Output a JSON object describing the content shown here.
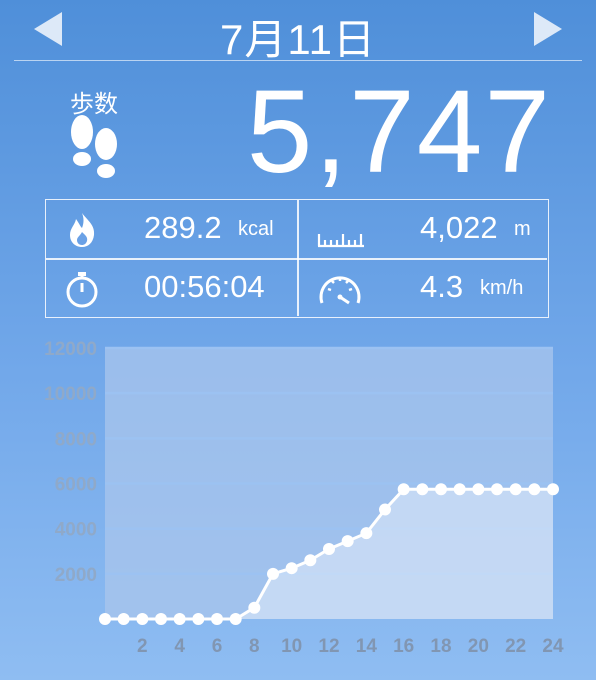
{
  "header": {
    "date": "7月11日",
    "prev_icon": "chevron-left-icon",
    "next_icon": "chevron-right-icon"
  },
  "steps": {
    "label": "歩数",
    "value": "5,747",
    "icon": "footprints-icon"
  },
  "stats": {
    "calories": {
      "value": "289.2",
      "unit": "kcal",
      "icon": "flame-icon"
    },
    "distance": {
      "value": "4,022",
      "unit": "m",
      "icon": "ruler-icon"
    },
    "time": {
      "value": "00:56:04",
      "unit": "",
      "icon": "stopwatch-icon"
    },
    "speed": {
      "value": "4.3",
      "unit": "km/h",
      "icon": "speedometer-icon"
    }
  },
  "colors": {
    "line": "#ffffff",
    "plot_bg": "#a9c6ec",
    "gridline": "#9cc2f2",
    "axis_text": "#8fa9c9"
  },
  "chart_data": {
    "type": "line",
    "x": [
      0,
      1,
      2,
      3,
      4,
      5,
      6,
      7,
      8,
      9,
      10,
      11,
      12,
      13,
      14,
      15,
      16,
      17,
      18,
      19,
      20,
      21,
      22,
      23,
      24
    ],
    "values": [
      0,
      0,
      0,
      0,
      0,
      0,
      0,
      0,
      500,
      2000,
      2250,
      2600,
      3100,
      3450,
      3800,
      4850,
      5747,
      5747,
      5747,
      5747,
      5747,
      5747,
      5747,
      5747,
      5747
    ],
    "xticks": [
      "2",
      "4",
      "6",
      "8",
      "10",
      "12",
      "14",
      "16",
      "18",
      "20",
      "22",
      "24"
    ],
    "yticks": [
      "2000",
      "4000",
      "6000",
      "8000",
      "10000",
      "12000"
    ],
    "ylim": [
      0,
      12000
    ],
    "xlim": [
      0,
      24
    ],
    "grid": true
  }
}
